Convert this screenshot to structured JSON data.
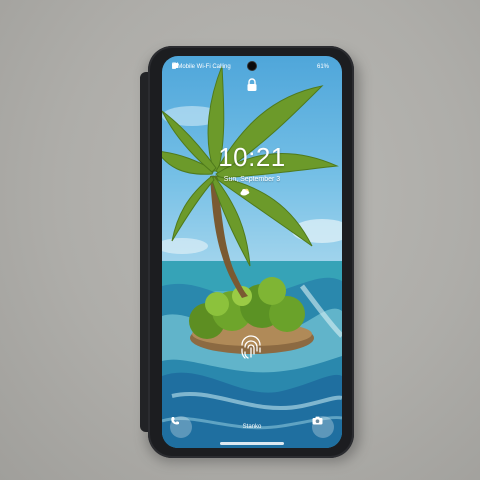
{
  "status_bar": {
    "carrier": "T-Mobile Wi-Fi Calling",
    "battery": "61%",
    "icons": [
      "alarm-icon",
      "mute-icon",
      "wifi-icon",
      "signal-icon",
      "battery-icon"
    ]
  },
  "lock_screen": {
    "lock_icon": "lock-icon",
    "time": "10:21",
    "date": "Sun, September 3",
    "weather_icons": [
      "cloud-sun-icon",
      "cloud-icon"
    ],
    "owner_name": "Stanko",
    "left_shortcut": "phone-icon",
    "right_shortcut": "camera-icon",
    "fingerprint": "fingerprint-icon"
  },
  "colors": {
    "phone_body": "#1c1d20",
    "sky": "#74bfe6",
    "water": "#2a8cab",
    "palm_leaves": "#6c9a2a",
    "background_wall": "#aeada9"
  }
}
